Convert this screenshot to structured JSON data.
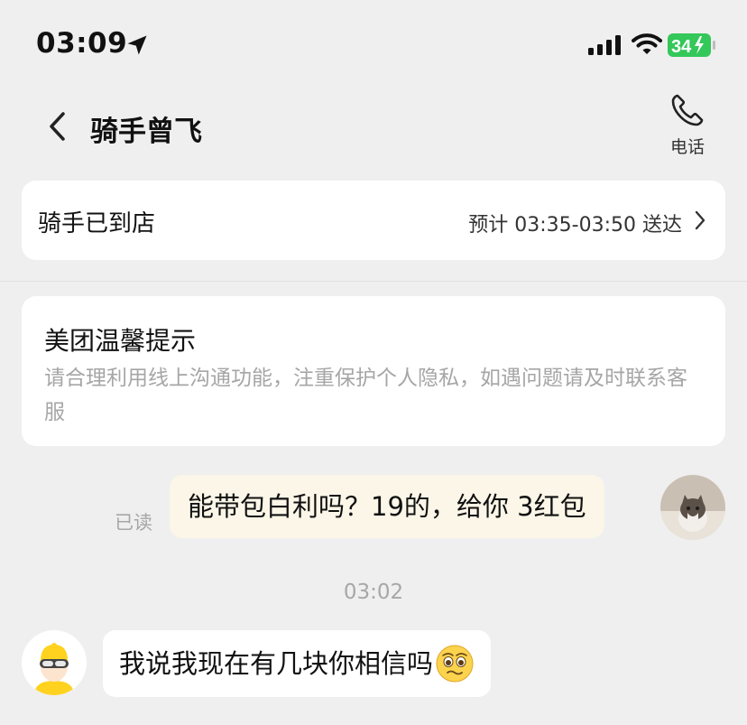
{
  "status_bar": {
    "time": "03:09",
    "battery": "34",
    "icons": [
      "location-arrow-icon",
      "signal-icon",
      "wifi-icon",
      "battery-charging-icon"
    ]
  },
  "header": {
    "title": "骑手曾飞",
    "phone_label": "电话"
  },
  "order_status": {
    "text": "骑手已到店",
    "eta": "预计 03:35-03:50 送达"
  },
  "tip": {
    "title": "美团温馨提示",
    "body": "请合理利用线上沟通功能，注重保护个人隐私，如遇问题请及时联系客服"
  },
  "messages": [
    {
      "from": "me",
      "read_label": "已读",
      "text": "能带包白利吗？19的，给你 3红包"
    },
    {
      "timestamp": "03:02"
    },
    {
      "from": "rider",
      "text": "我说我现在有几块你相信吗",
      "emoji": "woozy-face-emoji"
    }
  ],
  "colors": {
    "background": "#efefef",
    "my_bubble": "#fbf6e8",
    "battery_green": "#34c759",
    "rider_yellow": "#ffd21f"
  }
}
